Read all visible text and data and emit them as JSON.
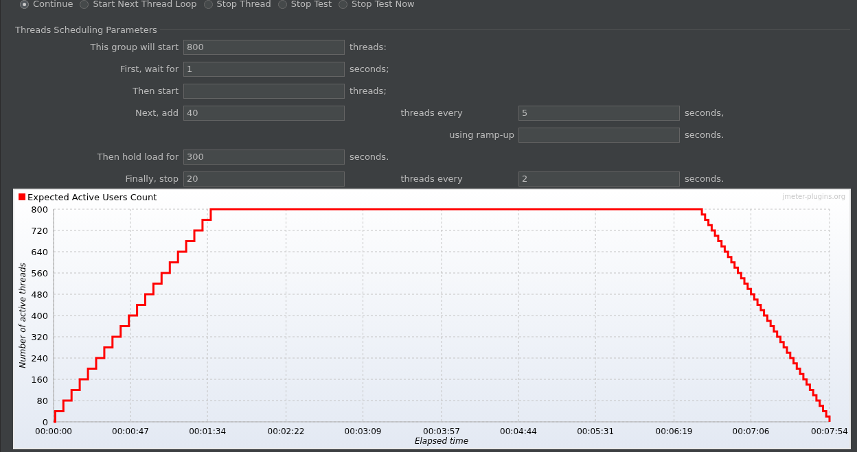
{
  "on_error_actions": [
    {
      "label": "Continue",
      "selected": true
    },
    {
      "label": "Start Next Thread Loop",
      "selected": false
    },
    {
      "label": "Stop Thread",
      "selected": false
    },
    {
      "label": "Stop Test",
      "selected": false
    },
    {
      "label": "Stop Test Now",
      "selected": false
    }
  ],
  "scheduling": {
    "title": "Threads Scheduling Parameters",
    "rows": [
      {
        "kind": "single",
        "label": "This group will start",
        "value": "800",
        "unit": "threads:"
      },
      {
        "kind": "single",
        "label": "First, wait for",
        "value": "1",
        "unit": "seconds;"
      },
      {
        "kind": "single",
        "label": "Then start",
        "unit": "threads;"
      },
      {
        "kind": "paired",
        "label": "Next, add",
        "value": "40",
        "second_label": "threads every",
        "second_value": "5",
        "second_unit": "seconds,"
      },
      {
        "kind": "second_only",
        "second_label": "using ramp-up",
        "second_unit": "seconds."
      },
      {
        "kind": "single",
        "label": "Then hold load for",
        "value": "300",
        "unit": "seconds."
      },
      {
        "kind": "paired",
        "label": "Finally, stop",
        "value": "20",
        "second_label": "threads every",
        "second_value": "2",
        "second_unit": "seconds."
      }
    ]
  },
  "chart": {
    "watermark": "jmeter-plugins.org",
    "chart_data": {
      "type": "line",
      "xlabel": "Elapsed time",
      "ylabel": "Number of active threads",
      "xlim": [
        0,
        474
      ],
      "ylim": [
        0,
        800
      ],
      "yticks": [
        0,
        80,
        160,
        240,
        320,
        400,
        480,
        560,
        640,
        720,
        800
      ],
      "grid": true,
      "xticks": [
        {
          "value": 0,
          "label": "00:00:00"
        },
        {
          "value": 47,
          "label": "00:00:47"
        },
        {
          "value": 94,
          "label": "00:01:34"
        },
        {
          "value": 142,
          "label": "00:02:22"
        },
        {
          "value": 189,
          "label": "00:03:09"
        },
        {
          "value": 237,
          "label": "00:03:57"
        },
        {
          "value": 284,
          "label": "00:04:44"
        },
        {
          "value": 331,
          "label": "00:05:31"
        },
        {
          "value": 379,
          "label": "00:06:19"
        },
        {
          "value": 426,
          "label": "00:07:06"
        },
        {
          "value": 474,
          "label": "00:07:54"
        }
      ],
      "x": [
        0,
        1,
        1,
        6,
        6,
        11,
        11,
        16,
        16,
        21,
        21,
        26,
        26,
        31,
        31,
        36,
        36,
        41,
        41,
        46,
        46,
        51,
        51,
        56,
        56,
        61,
        61,
        66,
        66,
        71,
        71,
        76,
        76,
        81,
        81,
        86,
        86,
        91,
        91,
        96,
        96,
        396,
        396,
        398,
        398,
        400,
        400,
        402,
        402,
        404,
        404,
        406,
        406,
        408,
        408,
        410,
        410,
        412,
        412,
        414,
        414,
        416,
        416,
        418,
        418,
        420,
        420,
        422,
        422,
        424,
        424,
        426,
        426,
        428,
        428,
        430,
        430,
        432,
        432,
        434,
        434,
        436,
        436,
        438,
        438,
        440,
        440,
        442,
        442,
        444,
        444,
        446,
        446,
        448,
        448,
        450,
        450,
        452,
        452,
        454,
        454,
        456,
        456,
        458,
        458,
        460,
        460,
        462,
        462,
        464,
        464,
        466,
        466,
        468,
        468,
        470,
        470,
        472,
        472,
        474,
        474
      ],
      "series": [
        {
          "name": "Expected Active Users Count",
          "color": "#ff0000",
          "values": [
            0,
            0,
            40,
            40,
            80,
            80,
            120,
            120,
            160,
            160,
            200,
            200,
            240,
            240,
            280,
            280,
            320,
            320,
            360,
            360,
            400,
            400,
            440,
            440,
            480,
            480,
            520,
            520,
            560,
            560,
            600,
            600,
            640,
            640,
            680,
            680,
            720,
            720,
            760,
            760,
            800,
            800,
            780,
            780,
            760,
            760,
            740,
            740,
            720,
            720,
            700,
            700,
            680,
            680,
            660,
            660,
            640,
            640,
            620,
            620,
            600,
            600,
            580,
            580,
            560,
            560,
            540,
            540,
            520,
            520,
            500,
            500,
            480,
            480,
            460,
            460,
            440,
            440,
            420,
            420,
            400,
            400,
            380,
            380,
            360,
            360,
            340,
            340,
            320,
            320,
            300,
            300,
            280,
            280,
            260,
            260,
            240,
            240,
            220,
            220,
            200,
            200,
            180,
            180,
            160,
            160,
            140,
            140,
            120,
            120,
            100,
            100,
            80,
            80,
            60,
            60,
            40,
            40,
            20,
            20,
            0
          ]
        }
      ]
    }
  }
}
